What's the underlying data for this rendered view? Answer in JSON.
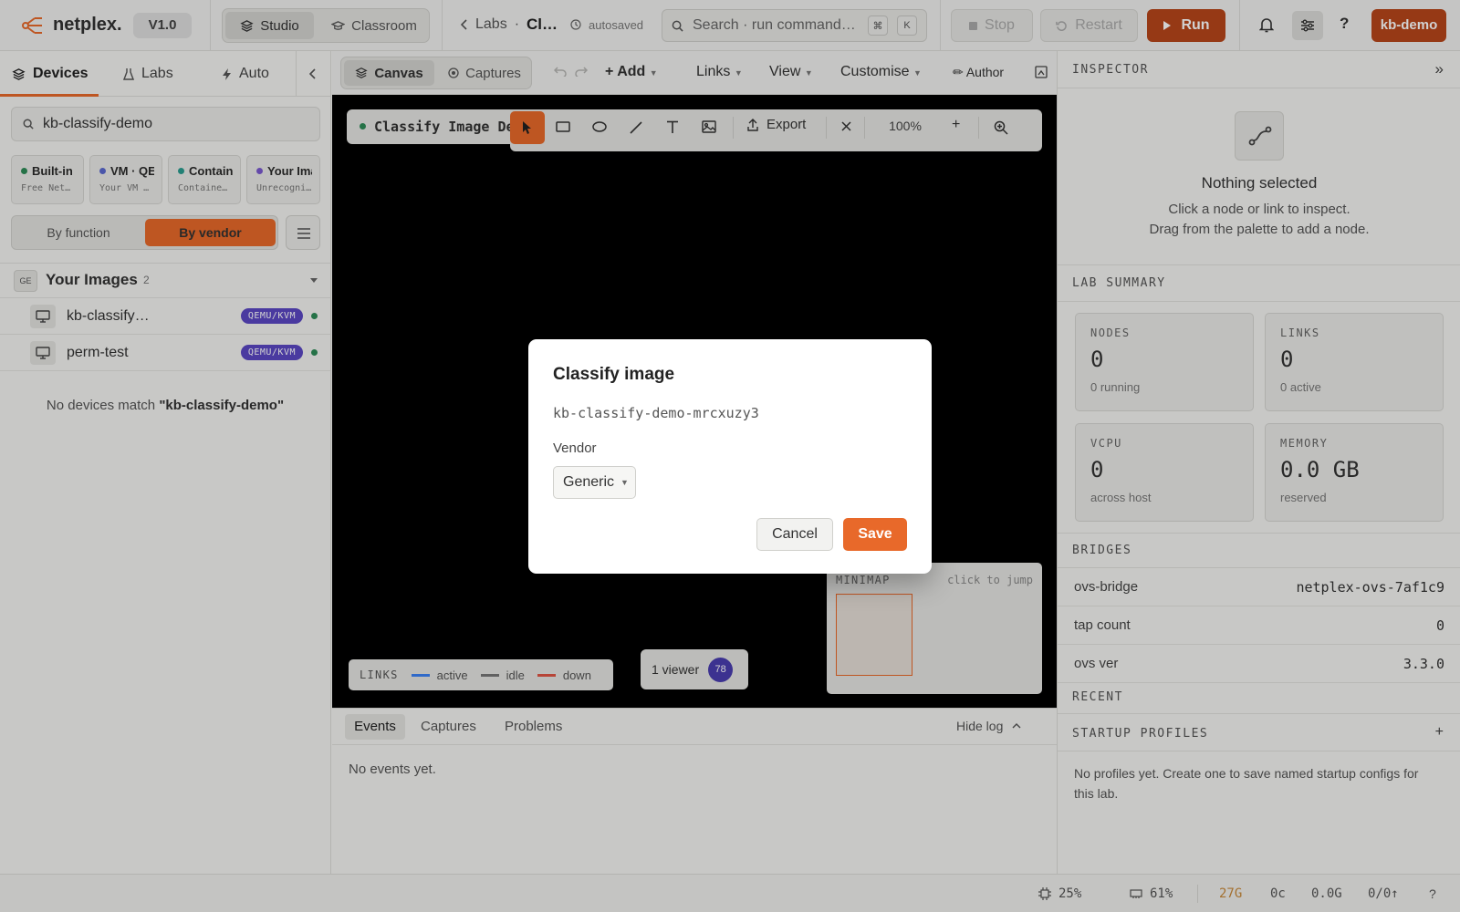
{
  "app": {
    "name": "netplex.",
    "version": "V1.0",
    "modes": [
      "Studio",
      "Classroom"
    ],
    "breadcrumb_parent": "Labs",
    "breadcrumb_sep": "·",
    "breadcrumb_current": "Cl…",
    "autosave": "autosaved",
    "search_placeholder": "Search · run command…",
    "kbd_1": "⌘",
    "kbd_2": "K",
    "stop": "Stop",
    "restart": "Restart",
    "run": "Run",
    "user": "kb-demo"
  },
  "sidebar": {
    "tabs": [
      "Devices",
      "Labs",
      "Auto"
    ],
    "search_value": "kb-classify-demo",
    "chips": [
      {
        "title": "Built-in",
        "sub": "Free Netplex",
        "color": "#2e8b57"
      },
      {
        "title": "VM · QEMU",
        "sub": "Your VM images",
        "color": "#5b6ad0"
      },
      {
        "title": "Containers",
        "sub": "Container images",
        "color": "#2a9d8f"
      },
      {
        "title": "Your Images",
        "sub": "Unrecognized",
        "color": "#7a5ad0"
      }
    ],
    "group_by": [
      "By function",
      "By vendor"
    ],
    "group_badge": "GE",
    "group_title": "Your Images",
    "group_count": "2",
    "devices": [
      {
        "name": "kb-classify…",
        "type": "QEMU/KVM"
      },
      {
        "name": "perm-test",
        "type": "QEMU/KVM"
      }
    ],
    "empty_prefix": "No devices match ",
    "empty_query": "\"kb-classify-demo\""
  },
  "toolbar": {
    "canvas": "Canvas",
    "captures": "Captures",
    "add": "+ Add",
    "links": "Links",
    "view": "View",
    "customise": "Customise",
    "author": "✏ Author"
  },
  "canvas": {
    "lab_title": "Classify Image De",
    "export": "Export",
    "zoom": "100%",
    "minimap_title": "MINIMAP",
    "minimap_hint": "click to jump",
    "legend_title": "LINKS",
    "legend": [
      {
        "label": "active",
        "color": "#3b82f6"
      },
      {
        "label": "idle",
        "color": "#777777"
      },
      {
        "label": "down",
        "color": "#e05545"
      }
    ],
    "viewers": "1 viewer",
    "viewer_badge": "78"
  },
  "log": {
    "tabs": [
      "Events",
      "Captures",
      "Problems"
    ],
    "hide": "Hide log",
    "empty": "No events yet."
  },
  "inspector": {
    "title": "INSPECTOR",
    "nothing": "Nothing selected",
    "hint1": "Click a node or link to inspect.",
    "hint2": "Drag from the palette to add a node.",
    "lab_summary": "LAB SUMMARY",
    "stats": [
      {
        "label": "NODES",
        "value": "0",
        "sub": "0 running"
      },
      {
        "label": "LINKS",
        "value": "0",
        "sub": "0 active"
      },
      {
        "label": "VCPU",
        "value": "0",
        "sub": "across host"
      },
      {
        "label": "MEMORY",
        "value": "0.0 GB",
        "sub": "reserved"
      }
    ],
    "bridges": "BRIDGES",
    "bridge_rows": [
      {
        "k": "ovs-bridge",
        "v": "netplex-ovs-7af1c9"
      },
      {
        "k": "tap count",
        "v": "0"
      },
      {
        "k": "ovs ver",
        "v": "3.3.0"
      }
    ],
    "recent": "RECENT",
    "startup": "STARTUP PROFILES",
    "startup_add": "+",
    "startup_empty": "No profiles yet. Create one to save named startup configs for this lab."
  },
  "status": {
    "cpu": "25%",
    "mem": "61%",
    "disk": "27G",
    "cores": "0c",
    "gb": "0.0G",
    "io": "0/0↑",
    "help": "?"
  },
  "modal": {
    "title": "Classify image",
    "image_id": "kb-classify-demo-mrcxuzy3",
    "vendor_label": "Vendor",
    "vendor_value": "Generic",
    "cancel": "Cancel",
    "save": "Save"
  },
  "colors": {
    "accent": "#e8692a",
    "brand_dark": "#b8461a",
    "qemu_badge": "#5b47c4",
    "canvas_bg": "#000000"
  }
}
